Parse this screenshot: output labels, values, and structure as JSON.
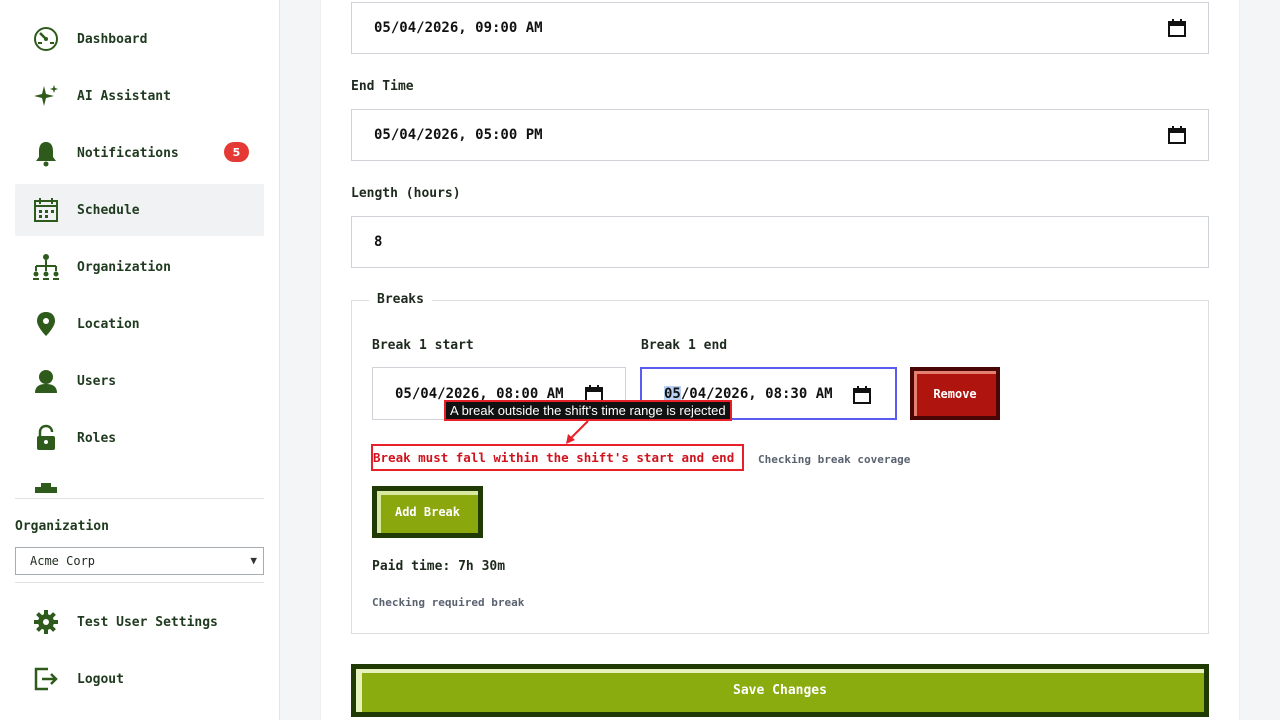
{
  "sidebar": {
    "items": [
      {
        "label": "Dashboard",
        "icon": "dashboard-icon"
      },
      {
        "label": "AI Assistant",
        "icon": "sparkle-icon"
      },
      {
        "label": "Notifications",
        "icon": "bell-icon",
        "badge": "5"
      },
      {
        "label": "Schedule",
        "icon": "calendar-icon",
        "active": true
      },
      {
        "label": "Organization",
        "icon": "org-chart-icon"
      },
      {
        "label": "Location",
        "icon": "location-pin-icon"
      },
      {
        "label": "Users",
        "icon": "user-icon"
      },
      {
        "label": "Roles",
        "icon": "lock-icon"
      }
    ],
    "organization_label": "Organization",
    "organization_value": "Acme Corp",
    "settings_label": "Test User Settings",
    "logout_label": "Logout"
  },
  "form": {
    "start_time_value": "05/04/2026, 09:00 AM",
    "end_time_label": "End Time",
    "end_time_value": "05/04/2026, 05:00 PM",
    "length_label": "Length (hours)",
    "length_value": "8",
    "breaks": {
      "legend": "Breaks",
      "break1_start_label": "Break 1 start",
      "break1_start_value": "05/04/2026, 08:00 AM",
      "break1_end_label": "Break 1 end",
      "break1_end_value_selected": "05",
      "break1_end_value_rest": "/04/2026, 08:30 AM",
      "remove_label": "Remove",
      "error": "Break must fall within the shift's start and end time",
      "coverage_hint": "Checking break coverage",
      "add_break_label": "Add Break",
      "paid_time": "Paid time: 7h 30m",
      "required_hint": "Checking required break"
    },
    "save_label": "Save Changes"
  },
  "annotation": {
    "tooltip": "A break outside the shift's time range is rejected"
  },
  "colors": {
    "accent_green": "#8aac0e",
    "dark_green": "#1f3a05",
    "danger": "#b0140e",
    "error": "#e8202a",
    "focus": "#5a5cf0",
    "badge": "#e53935"
  }
}
